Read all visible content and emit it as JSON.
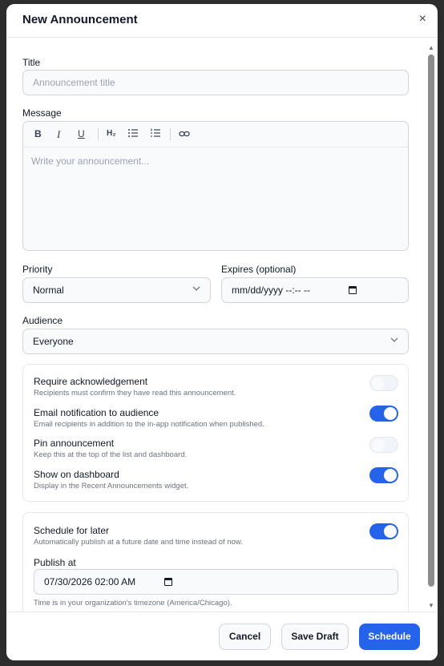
{
  "modal": {
    "title": "New Announcement",
    "close_symbol": "×"
  },
  "form": {
    "title_label": "Title",
    "title_placeholder": "Announcement title",
    "message_label": "Message",
    "message_placeholder": "Write your announcement...",
    "toolbar": {
      "bold": "B",
      "italic": "I",
      "underline": "U",
      "heading": "H₂"
    },
    "priority_label": "Priority",
    "priority_value": "Normal",
    "expires_label": "Expires (optional)",
    "expires_value": "mm/dd/yyyy --:-- --",
    "audience_label": "Audience",
    "audience_value": "Everyone"
  },
  "options": [
    {
      "title": "Require acknowledgement",
      "desc": "Recipients must confirm they have read this announcement.",
      "enabled": false
    },
    {
      "title": "Email notification to audience",
      "desc": "Email recipients in addition to the in-app notification when published.",
      "enabled": true
    },
    {
      "title": "Pin announcement",
      "desc": "Keep this at the top of the list and dashboard.",
      "enabled": false
    },
    {
      "title": "Show on dashboard",
      "desc": "Display in the Recent Announcements widget.",
      "enabled": true
    }
  ],
  "schedule": {
    "title": "Schedule for later",
    "desc": "Automatically publish at a future date and time instead of now.",
    "enabled": true,
    "publish_label": "Publish at",
    "publish_value": "07/30/2026 02:00 AM",
    "timezone_note": "Time is in your organization's timezone (America/Chicago)."
  },
  "footer": {
    "cancel": "Cancel",
    "save_draft": "Save Draft",
    "schedule": "Schedule"
  },
  "colors": {
    "accent": "#2563eb",
    "border": "#d1d5db",
    "muted": "#6b7280"
  }
}
